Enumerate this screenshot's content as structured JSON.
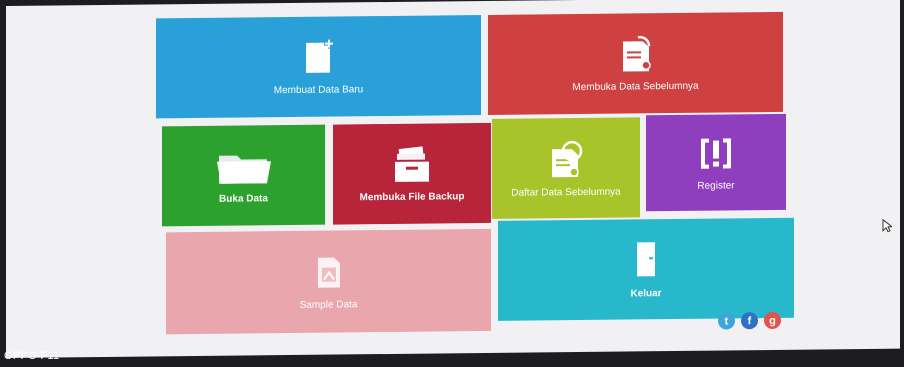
{
  "tiles": {
    "new_data": {
      "label": "Membuat Data Baru",
      "icon": "new-document-icon",
      "color": "#29a1d8"
    },
    "open_previous": {
      "label": "Membuka Data Sebelumnya",
      "icon": "open-document-icon",
      "color": "#cf4041"
    },
    "open_data": {
      "label": "Buka Data",
      "icon": "folder-icon",
      "color": "#2ca12e"
    },
    "open_backup": {
      "label": "Membuka File Backup",
      "icon": "backup-box-icon",
      "color": "#b8243a"
    },
    "previous_list": {
      "label": "Daftar Data Sebelumnya",
      "icon": "document-history-icon",
      "color": "#a8c42a"
    },
    "register": {
      "label": "Register",
      "icon": "register-alert-icon",
      "color": "#8f3fbe"
    },
    "sample": {
      "label": "Sample Data",
      "icon": "sample-document-icon",
      "color": "#e9a6ad"
    },
    "exit": {
      "label": "Keluar",
      "icon": "exit-door-icon",
      "color": "#27b8cb"
    }
  },
  "social": [
    "twitter-icon",
    "facebook-icon",
    "google-plus-icon"
  ],
  "watermark": "OPPO F11"
}
